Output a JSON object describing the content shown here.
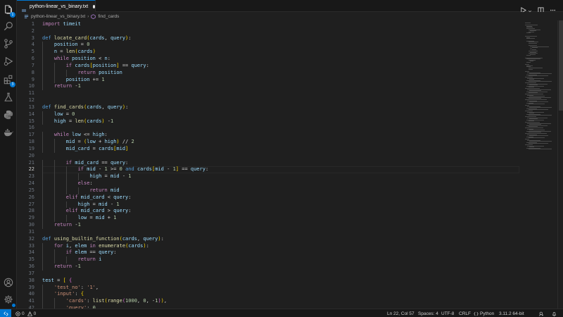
{
  "tab": {
    "filename": "python-linear_vs_binary.txt",
    "modified": true
  },
  "breadcrumb": {
    "file": "python-linear_vs_binary.txt",
    "symbol": "find_cards"
  },
  "activity": {
    "explorer_badge": "1",
    "extensions_badge": "3"
  },
  "editor": {
    "current_line": 22,
    "lines": [
      "import timeit",
      "",
      "def locate_card(cards, query):",
      "    position = 0",
      "    n = len(cards)",
      "    while position < n:",
      "        if cards[position] == query:",
      "            return position",
      "        position += 1",
      "    return -1",
      "",
      "",
      "def find_cards(cards, query):",
      "    low = 0",
      "    high = len(cards) -1",
      "",
      "    while low <= high:",
      "        mid = (low + high) // 2",
      "        mid_card = cards[mid]",
      "",
      "        if mid_card == query:",
      "            if mid - 1 >= 0 and cards[mid - 1] == query:",
      "                high = mid - 1",
      "            else:",
      "                return mid",
      "        elif mid_card < query:",
      "            high = mid - 1",
      "        elif mid_card > query:",
      "            low = mid + 1",
      "    return -1",
      "",
      "def using_builtin_function(cards, query):",
      "    for i, elem in enumerate(cards):",
      "        if elem == query:",
      "            return i",
      "    return -1",
      "",
      "test = [ {",
      "    'test_no': '1',",
      "    'input': {",
      "        'cards': list(range(1000, 0, -1)),",
      "        'query': 0"
    ]
  },
  "status": {
    "errors": "0",
    "warnings": "0",
    "position": "Ln 22, Col 57",
    "spaces": "Spaces: 4",
    "encoding": "UTF-8",
    "eol": "CRLF",
    "language": "Python",
    "interpreter": "3.11.2 64-bit"
  }
}
